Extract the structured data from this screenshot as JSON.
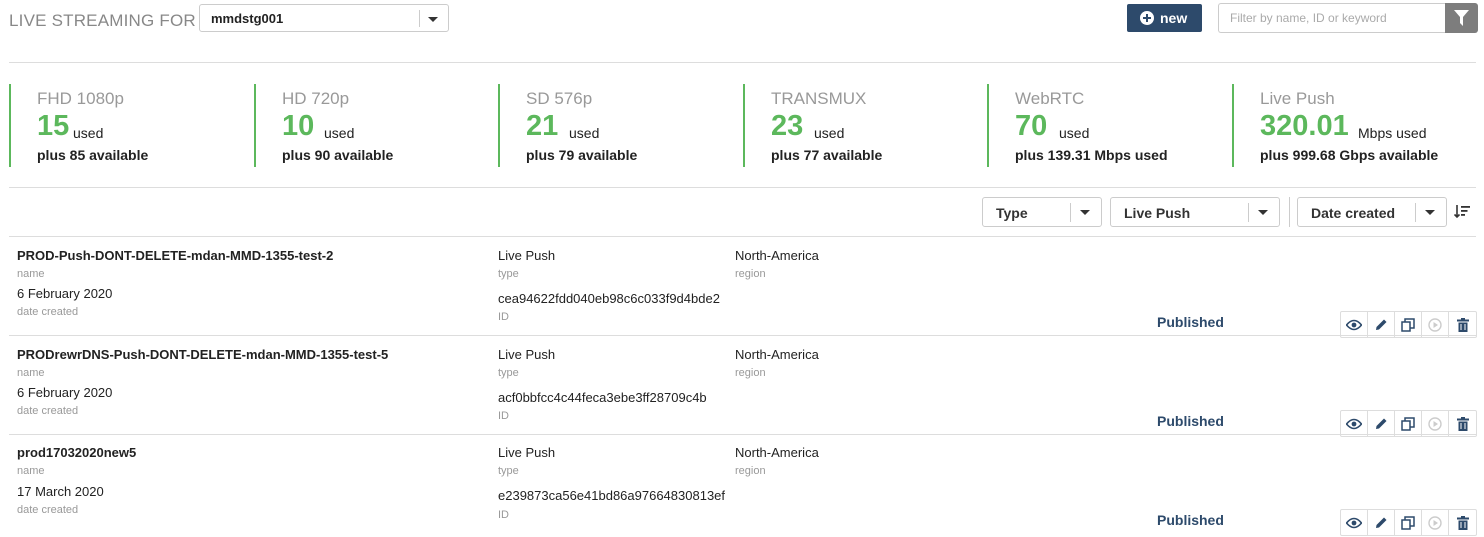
{
  "header": {
    "title": "LIVE STREAMING FOR",
    "account": "mmdstg001",
    "new_label": "new",
    "search_placeholder": "Filter by name, ID or keyword"
  },
  "stats": [
    {
      "label": "FHD 1080p",
      "value": "15",
      "unit": "used",
      "extra": "plus 85 available"
    },
    {
      "label": "HD 720p",
      "value": "10",
      "unit": "used",
      "extra": "plus 90 available"
    },
    {
      "label": "SD 576p",
      "value": "21",
      "unit": "used",
      "extra": "plus 79 available"
    },
    {
      "label": "TRANSMUX",
      "value": "23",
      "unit": "used",
      "extra": "plus 77 available"
    },
    {
      "label": "WebRTC",
      "value": "70",
      "unit": "used",
      "extra": "plus 139.31 Mbps used"
    },
    {
      "label": "Live Push",
      "value": "320.01",
      "unit": "Mbps used",
      "extra": "plus 999.68 Gbps available"
    }
  ],
  "filters": {
    "type": "Type",
    "type_value": "Live Push",
    "sort": "Date created"
  },
  "labels": {
    "name": "name",
    "date": "date created",
    "type": "type",
    "id": "ID",
    "region": "region"
  },
  "rows": [
    {
      "name": "PROD-Push-DONT-DELETE-mdan-MMD-1355-test-2",
      "date": "6 February 2020",
      "type": "Live Push",
      "id": "cea94622fdd040eb98c6c033f9d4bde2",
      "region": "North-America",
      "status": "Published"
    },
    {
      "name": "PRODrewrDNS-Push-DONT-DELETE-mdan-MMD-1355-test-5",
      "date": "6 February 2020",
      "type": "Live Push",
      "id": "acf0bbfcc4c44feca3ebe3ff28709c4b",
      "region": "North-America",
      "status": "Published"
    },
    {
      "name": "prod17032020new5",
      "date": "17 March 2020",
      "type": "Live Push",
      "id": "e239873ca56e41bd86a97664830813ef",
      "region": "North-America",
      "status": "Published"
    }
  ],
  "colors": {
    "accent_green": "#5cb85c",
    "brand_navy": "#2d4a6b",
    "filter_gray": "#7d7d7d"
  }
}
